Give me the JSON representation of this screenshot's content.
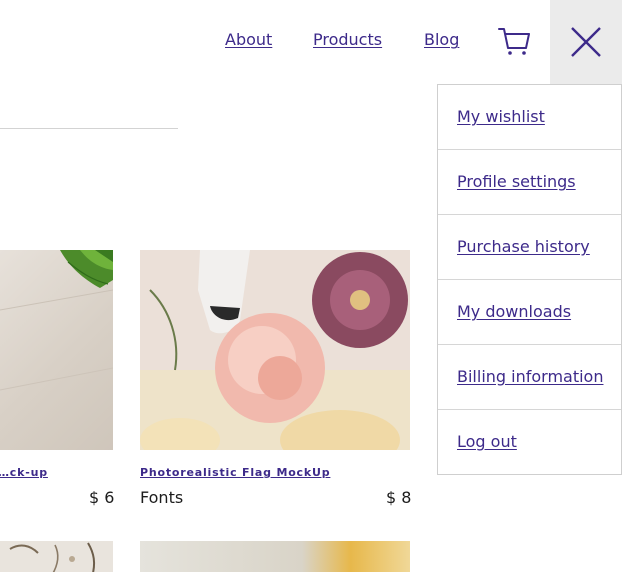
{
  "header": {
    "nav": [
      {
        "label": "About"
      },
      {
        "label": "Products"
      },
      {
        "label": "Blog"
      }
    ],
    "cart_icon": "shopping-cart-icon",
    "close_icon": "close-icon"
  },
  "products": [
    {
      "title": "…ck-up",
      "price": "$ 6"
    },
    {
      "title": "Photorealistic Flag MockUp",
      "category": "Fonts",
      "price": "$ 8"
    }
  ],
  "account_menu": {
    "items": [
      {
        "label": "My wishlist"
      },
      {
        "label": "Profile settings"
      },
      {
        "label": "Purchase history"
      },
      {
        "label": "My downloads"
      },
      {
        "label": "Billing information"
      },
      {
        "label": "Log out"
      }
    ]
  },
  "colors": {
    "link": "#3d2a8a",
    "close_bg": "#ebebeb",
    "divider": "#d6d6d6"
  }
}
